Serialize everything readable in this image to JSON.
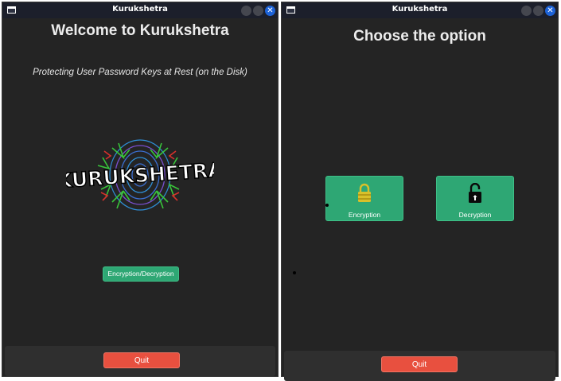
{
  "left_window": {
    "title": "Kurukshetra",
    "heading": "Welcome to Kurukshetra",
    "subtitle": "Protecting User Password Keys at Rest (on the Disk)",
    "logo_text": "KURUKSHETRA",
    "encrypt_decrypt_label": "Encryption/Decryption",
    "quit_label": "Quit"
  },
  "right_window": {
    "title": "Kurukshetra",
    "heading": "Choose the option",
    "options": [
      {
        "label": "Encryption",
        "icon": "lock-closed-icon"
      },
      {
        "label": "Decryption",
        "icon": "lock-open-icon"
      }
    ],
    "quit_label": "Quit"
  },
  "colors": {
    "background": "#242424",
    "titlebar": "#1c1f2b",
    "accent_green": "#2ea774",
    "quit_red": "#e8503f",
    "close_blue": "#1d63d8",
    "lock_closed": "#d8c02a"
  }
}
